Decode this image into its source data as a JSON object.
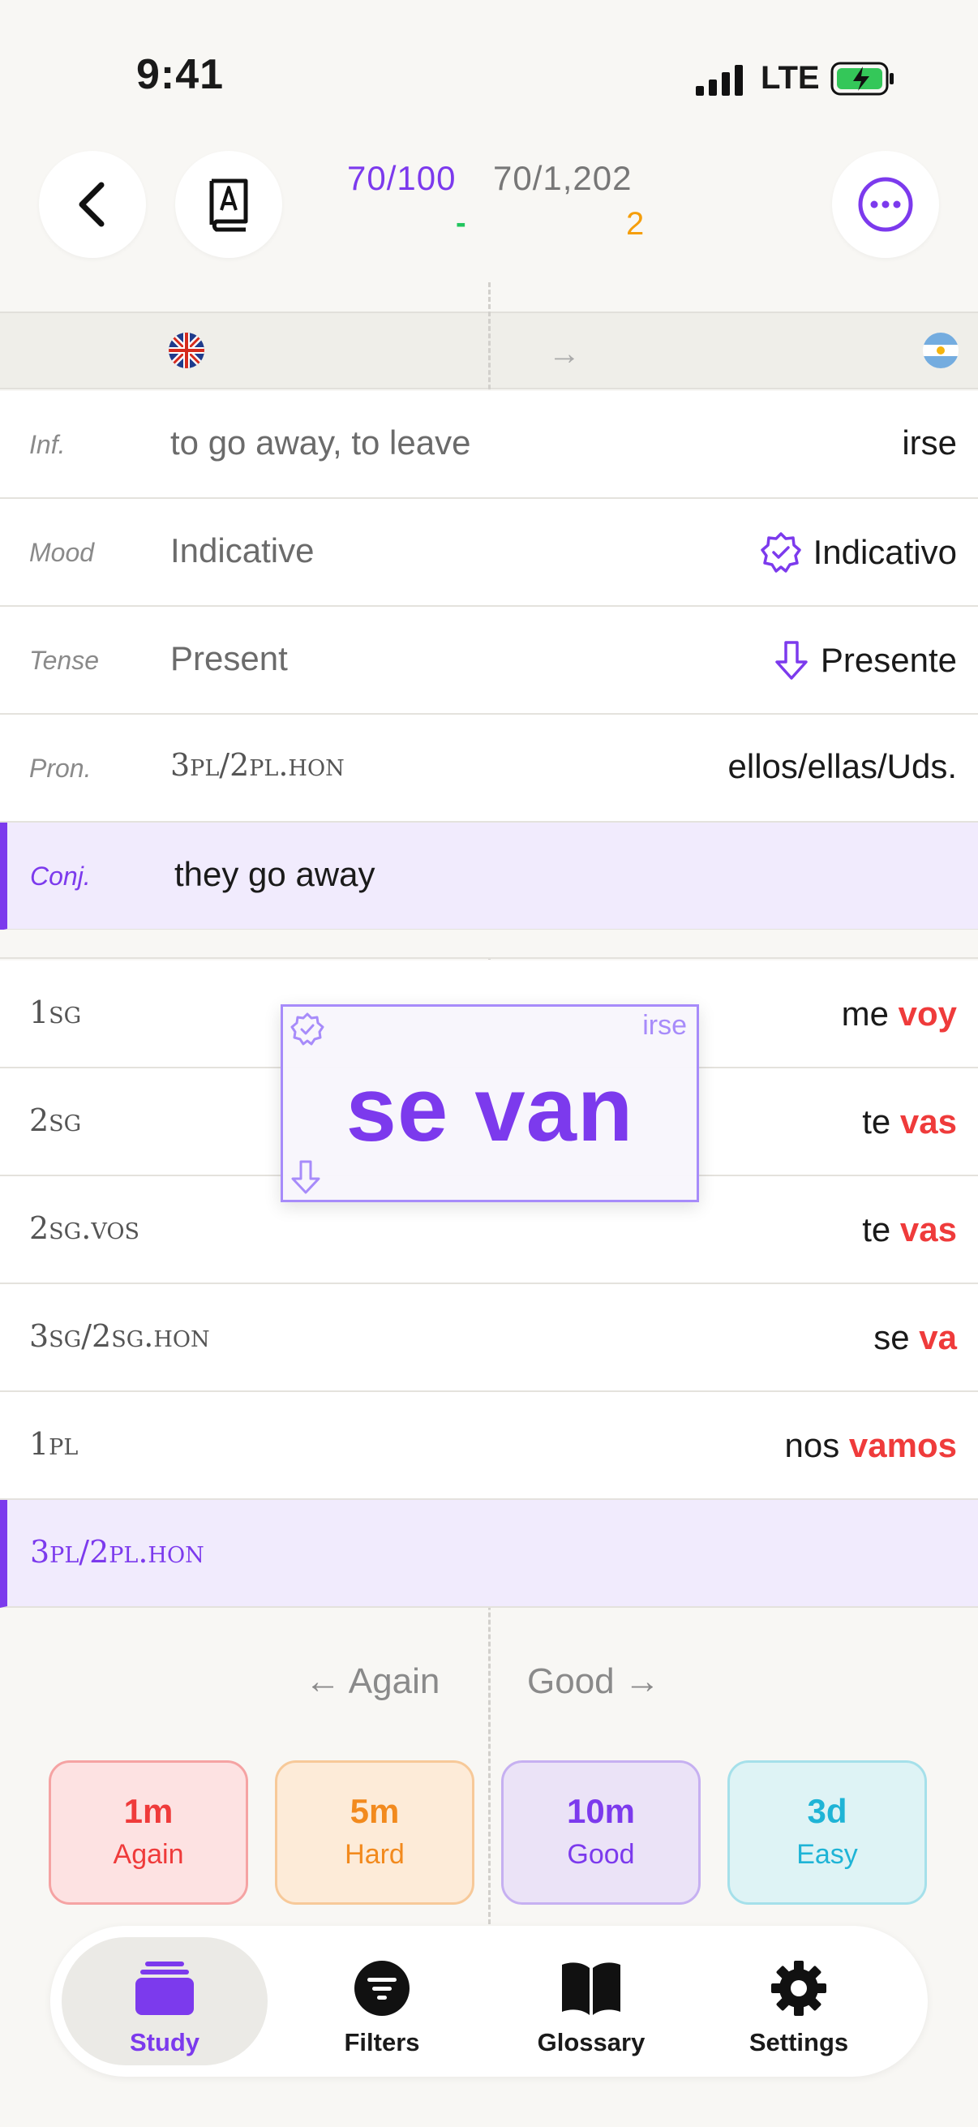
{
  "status_bar": {
    "time": "9:41",
    "network": "LTE"
  },
  "header": {
    "progress_session": "70/100",
    "progress_total": "70/1,202",
    "correct_mark": "-",
    "hard_count": "2"
  },
  "languages": {
    "arrow": "→"
  },
  "info_rows": [
    {
      "label": "Inf.",
      "english": "to go away, to leave",
      "spanish": "irse"
    },
    {
      "label": "Mood",
      "english": "Indicative",
      "spanish": "Indicativo",
      "icon": "verified-badge-icon"
    },
    {
      "label": "Tense",
      "english": "Present",
      "spanish": "Presente",
      "icon": "arrow-down-icon"
    },
    {
      "label": "Pron.",
      "english": "3pl/2pl.hon",
      "spanish": "ellos/ellas/Uds."
    },
    {
      "label": "Conj.",
      "english": "they go away"
    }
  ],
  "conjugation_rows": [
    {
      "person": "1sg",
      "prefix": "me ",
      "ending": "voy"
    },
    {
      "person": "2sg",
      "prefix": "te ",
      "ending": "vas"
    },
    {
      "person": "2sg.vos",
      "prefix": "te ",
      "ending": "vas"
    },
    {
      "person": "3sg/2sg.hon",
      "prefix": "se ",
      "ending": "va"
    },
    {
      "person": "1pl",
      "prefix": "nos ",
      "ending": "vamos"
    },
    {
      "person": "3pl/2pl.hon"
    }
  ],
  "answer_card": {
    "answer": "se van",
    "infinitive": "irse"
  },
  "swipe_hints": {
    "left": "← Again",
    "right": "Good →"
  },
  "ratings": [
    {
      "time": "1m",
      "label": "Again",
      "color": "#ef3b3b",
      "bg": "#fde2e2",
      "border": "#f5a3a3"
    },
    {
      "time": "5m",
      "label": "Hard",
      "color": "#f28a1e",
      "bg": "#fdebd8",
      "border": "#f7c999"
    },
    {
      "time": "10m",
      "label": "Good",
      "color": "#7c3aed",
      "bg": "#ebe3f7",
      "border": "#c6b0f1"
    },
    {
      "time": "3d",
      "label": "Easy",
      "color": "#1fb4d6",
      "bg": "#def3f5",
      "border": "#a5e0ea"
    }
  ],
  "tabs": [
    {
      "label": "Study",
      "icon": "stack-icon",
      "selected": true
    },
    {
      "label": "Filters",
      "icon": "filter-icon"
    },
    {
      "label": "Glossary",
      "icon": "book-icon"
    },
    {
      "label": "Settings",
      "icon": "gear-icon"
    }
  ],
  "colors": {
    "accent": "#7c3aed",
    "red": "#ef3b3b",
    "background": "#f8f7f4"
  }
}
